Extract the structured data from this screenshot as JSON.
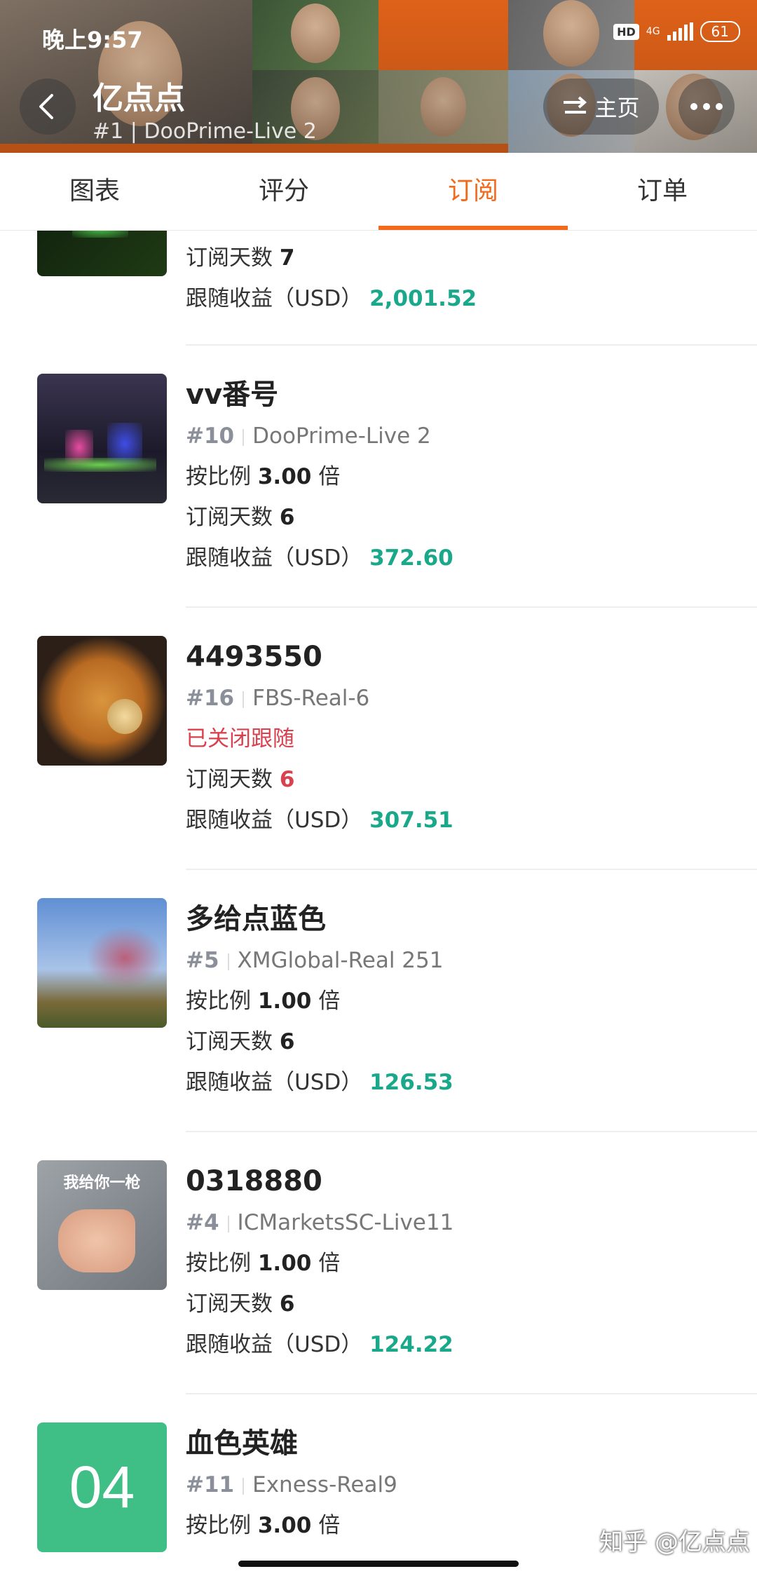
{
  "status_bar": {
    "time": "晚上9:57",
    "hd": "HD",
    "network": "4G",
    "battery": "61"
  },
  "header": {
    "title": "亿点点",
    "subtitle": "#1 | DooPrime-Live 2",
    "home_label": "主页"
  },
  "tabs": [
    {
      "label": "图表"
    },
    {
      "label": "评分"
    },
    {
      "label": "订阅",
      "active": true
    },
    {
      "label": "订单"
    }
  ],
  "labels": {
    "ratio": "按比例",
    "ratio_unit": "倍",
    "days": "订阅天数",
    "profit": "跟随收益（USD）",
    "closed": "已关闭跟随"
  },
  "items": [
    {
      "days": "7",
      "profit": "2,001.52"
    },
    {
      "name": "vv番号",
      "rank": "#10",
      "server": "DooPrime-Live 2",
      "ratio": "3.00",
      "days": "6",
      "profit": "372.60"
    },
    {
      "name": "4493550",
      "rank": "#16",
      "server": "FBS-Real-6",
      "days": "6",
      "profit": "307.51"
    },
    {
      "name": "多给点蓝色",
      "rank": "#5",
      "server": "XMGlobal-Real 251",
      "ratio": "1.00",
      "days": "6",
      "profit": "126.53"
    },
    {
      "name": "0318880",
      "rank": "#4",
      "server": "ICMarketsSC-Live11",
      "ratio": "1.00",
      "days": "6",
      "profit": "124.22",
      "thumb_text": "我给你一枪"
    },
    {
      "name": "血色英雄",
      "rank": "#11",
      "server": "Exness-Real9",
      "ratio": "3.00",
      "thumb_text": "04"
    }
  ],
  "watermark": "知乎 @亿点点"
}
